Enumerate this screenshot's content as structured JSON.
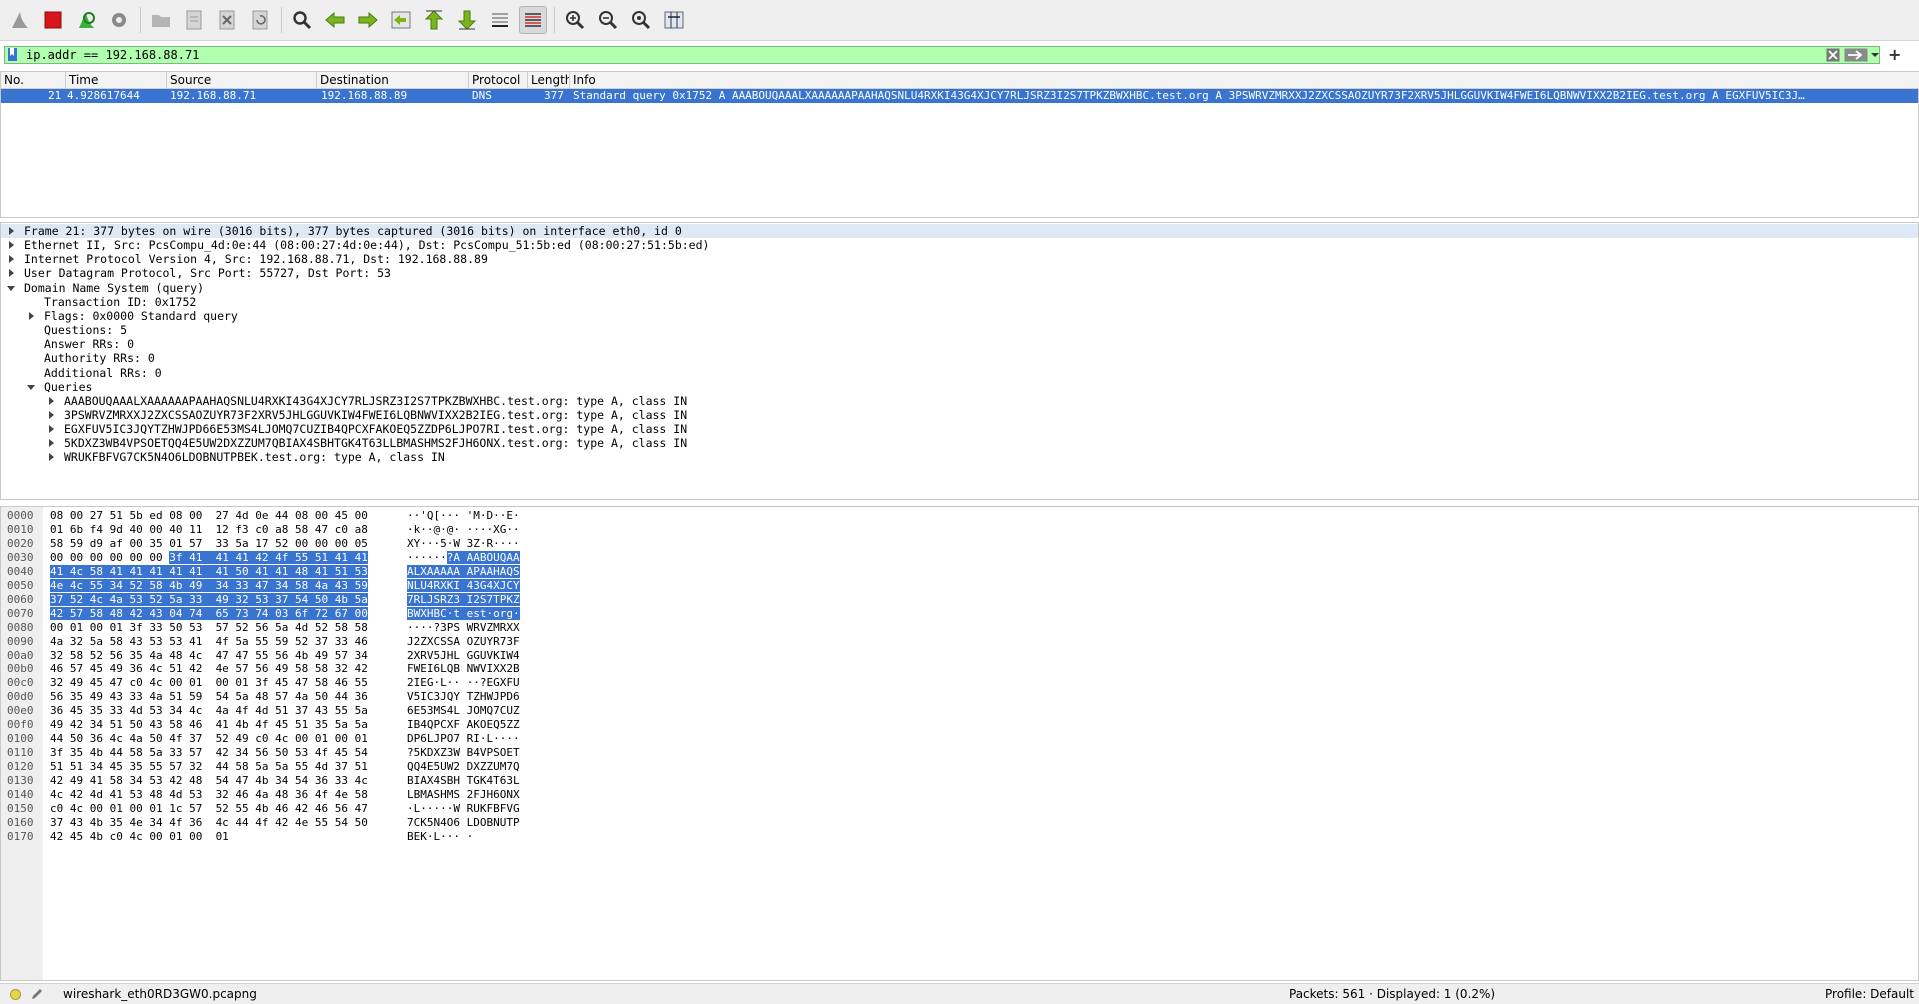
{
  "filter": {
    "value": "ip.addr == 192.168.88.71"
  },
  "columns": [
    "No.",
    "Time",
    "Source",
    "Destination",
    "Protocol",
    "Length",
    "Info"
  ],
  "packet": {
    "no": "21",
    "time": "4.928617644",
    "source": "192.168.88.71",
    "destination": "192.168.88.89",
    "protocol": "DNS",
    "length": "377",
    "info": "Standard query 0x1752 A AAABOUQAAALXAAAAAAPAAHAQSNLU4RXKI43G4XJCY7RLJSRZ3I2S7TPKZBWXHBC.test.org A 3PSWRVZMRXXJ2ZXCSSAOZUYR73F2XRV5JHLGGUVKIW4FWEI6LQBNWVIXX2B2IEG.test.org A EGXFUV5IC3J…"
  },
  "details": [
    {
      "text": "Frame 21: 377 bytes on wire (3016 bits), 377 bytes captured (3016 bits) on interface eth0, id 0",
      "level": 0,
      "arrow": "right"
    },
    {
      "text": "Ethernet II, Src: PcsCompu_4d:0e:44 (08:00:27:4d:0e:44), Dst: PcsCompu_51:5b:ed (08:00:27:51:5b:ed)",
      "level": 0,
      "arrow": "right"
    },
    {
      "text": "Internet Protocol Version 4, Src: 192.168.88.71, Dst: 192.168.88.89",
      "level": 0,
      "arrow": "right"
    },
    {
      "text": "User Datagram Protocol, Src Port: 55727, Dst Port: 53",
      "level": 0,
      "arrow": "right"
    },
    {
      "text": "Domain Name System (query)",
      "level": 0,
      "arrow": "down"
    },
    {
      "text": "Transaction ID: 0x1752",
      "level": 1,
      "arrow": "none"
    },
    {
      "text": "Flags: 0x0000 Standard query",
      "level": 1,
      "arrow": "right"
    },
    {
      "text": "Questions: 5",
      "level": 1,
      "arrow": "none"
    },
    {
      "text": "Answer RRs: 0",
      "level": 1,
      "arrow": "none"
    },
    {
      "text": "Authority RRs: 0",
      "level": 1,
      "arrow": "none"
    },
    {
      "text": "Additional RRs: 0",
      "level": 1,
      "arrow": "none"
    },
    {
      "text": "Queries",
      "level": 1,
      "arrow": "down"
    },
    {
      "text": "AAABOUQAAALXAAAAAAPAAHAQSNLU4RXKI43G4XJCY7RLJSRZ3I2S7TPKZBWXHBC.test.org: type A, class IN",
      "level": 2,
      "arrow": "right"
    },
    {
      "text": "3PSWRVZMRXXJ2ZXCSSAOZUYR73F2XRV5JHLGGUVKIW4FWEI6LQBNWVIXX2B2IEG.test.org: type A, class IN",
      "level": 2,
      "arrow": "right"
    },
    {
      "text": "EGXFUV5IC3JQYTZHWJPD66E53MS4LJOMQ7CUZIB4QPCXFAKOEQ5ZZDP6LJPO7RI.test.org: type A, class IN",
      "level": 2,
      "arrow": "right"
    },
    {
      "text": "5KDXZ3WB4VPSOETQQ4E5UW2DXZZUM7QBIAX4SBHTGK4T63LLBMASHMS2FJH6ONX.test.org: type A, class IN",
      "level": 2,
      "arrow": "right"
    },
    {
      "text": "WRUKFBFVG7CK5N4O6LDOBNUTPBEK.test.org: type A, class IN",
      "level": 2,
      "arrow": "right"
    }
  ],
  "bytes": [
    {
      "off": "0000",
      "hex": "08 00 27 51 5b ed 08 00  27 4d 0e 44 08 00 45 00",
      "asc": "··'Q[··· 'M·D··E·",
      "hlFrom": -1
    },
    {
      "off": "0010",
      "hex": "01 6b f4 9d 40 00 40 11  12 f3 c0 a8 58 47 c0 a8",
      "asc": "·k··@·@· ····XG··",
      "hlFrom": -1
    },
    {
      "off": "0020",
      "hex": "58 59 d9 af 00 35 01 57  33 5a 17 52 00 00 00 05",
      "asc": "XY···5·W 3Z·R····",
      "hlFrom": -1
    },
    {
      "off": "0030",
      "hex": "00 00 00 00 00 00 3f 41  41 41 42 4f 55 51 41 41",
      "asc": "······?A AABOUQAA",
      "hlFrom": 6
    },
    {
      "off": "0040",
      "hex": "41 4c 58 41 41 41 41 41  41 50 41 41 48 41 51 53",
      "asc": "ALXAAAAA APAAHAQS",
      "hlFrom": 0
    },
    {
      "off": "0050",
      "hex": "4e 4c 55 34 52 58 4b 49  34 33 47 34 58 4a 43 59",
      "asc": "NLU4RXKI 43G4XJCY",
      "hlFrom": 0
    },
    {
      "off": "0060",
      "hex": "37 52 4c 4a 53 52 5a 33  49 32 53 37 54 50 4b 5a",
      "asc": "7RLJSRZ3 I2S7TPKZ",
      "hlFrom": 0
    },
    {
      "off": "0070",
      "hex": "42 57 58 48 42 43 04 74  65 73 74 03 6f 72 67 00",
      "asc": "BWXHBC·t est·org·",
      "hlFrom": 0
    },
    {
      "off": "0080",
      "hex": "00 01 00 01 3f 33 50 53  57 52 56 5a 4d 52 58 58",
      "asc": "····?3PS WRVZMRXX",
      "hlFrom": -1
    },
    {
      "off": "0090",
      "hex": "4a 32 5a 58 43 53 53 41  4f 5a 55 59 52 37 33 46",
      "asc": "J2ZXCSSA OZUYR73F",
      "hlFrom": -1
    },
    {
      "off": "00a0",
      "hex": "32 58 52 56 35 4a 48 4c  47 47 55 56 4b 49 57 34",
      "asc": "2XRV5JHL GGUVKIW4",
      "hlFrom": -1
    },
    {
      "off": "00b0",
      "hex": "46 57 45 49 36 4c 51 42  4e 57 56 49 58 58 32 42",
      "asc": "FWEI6LQB NWVIXX2B",
      "hlFrom": -1
    },
    {
      "off": "00c0",
      "hex": "32 49 45 47 c0 4c 00 01  00 01 3f 45 47 58 46 55",
      "asc": "2IEG·L·· ··?EGXFU",
      "hlFrom": -1
    },
    {
      "off": "00d0",
      "hex": "56 35 49 43 33 4a 51 59  54 5a 48 57 4a 50 44 36",
      "asc": "V5IC3JQY TZHWJPD6",
      "hlFrom": -1
    },
    {
      "off": "00e0",
      "hex": "36 45 35 33 4d 53 34 4c  4a 4f 4d 51 37 43 55 5a",
      "asc": "6E53MS4L JOMQ7CUZ",
      "hlFrom": -1
    },
    {
      "off": "00f0",
      "hex": "49 42 34 51 50 43 58 46  41 4b 4f 45 51 35 5a 5a",
      "asc": "IB4QPCXF AKOEQ5ZZ",
      "hlFrom": -1
    },
    {
      "off": "0100",
      "hex": "44 50 36 4c 4a 50 4f 37  52 49 c0 4c 00 01 00 01",
      "asc": "DP6LJPO7 RI·L····",
      "hlFrom": -1
    },
    {
      "off": "0110",
      "hex": "3f 35 4b 44 58 5a 33 57  42 34 56 50 53 4f 45 54",
      "asc": "?5KDXZ3W B4VPSOET",
      "hlFrom": -1
    },
    {
      "off": "0120",
      "hex": "51 51 34 45 35 55 57 32  44 58 5a 5a 55 4d 37 51",
      "asc": "QQ4E5UW2 DXZZUM7Q",
      "hlFrom": -1
    },
    {
      "off": "0130",
      "hex": "42 49 41 58 34 53 42 48  54 47 4b 34 54 36 33 4c",
      "asc": "BIAX4SBH TGK4T63L",
      "hlFrom": -1
    },
    {
      "off": "0140",
      "hex": "4c 42 4d 41 53 48 4d 53  32 46 4a 48 36 4f 4e 58",
      "asc": "LBMASHMS 2FJH6ONX",
      "hlFrom": -1
    },
    {
      "off": "0150",
      "hex": "c0 4c 00 01 00 01 1c 57  52 55 4b 46 42 46 56 47",
      "asc": "·L·····W RUKFBFVG",
      "hlFrom": -1
    },
    {
      "off": "0160",
      "hex": "37 43 4b 35 4e 34 4f 36  4c 44 4f 42 4e 55 54 50",
      "asc": "7CK5N4O6 LDOBNUTP",
      "hlFrom": -1
    },
    {
      "off": "0170",
      "hex": "42 45 4b c0 4c 00 01 00  01",
      "asc": "BEK·L··· ·",
      "hlFrom": -1
    }
  ],
  "status": {
    "file": "wireshark_eth0RD3GW0.pcapng",
    "packets": "Packets: 561 · Displayed: 1 (0.2%)",
    "profile": "Profile: Default"
  },
  "colors": {
    "selection": "#3874d0",
    "filter_ok": "#afffaf"
  }
}
